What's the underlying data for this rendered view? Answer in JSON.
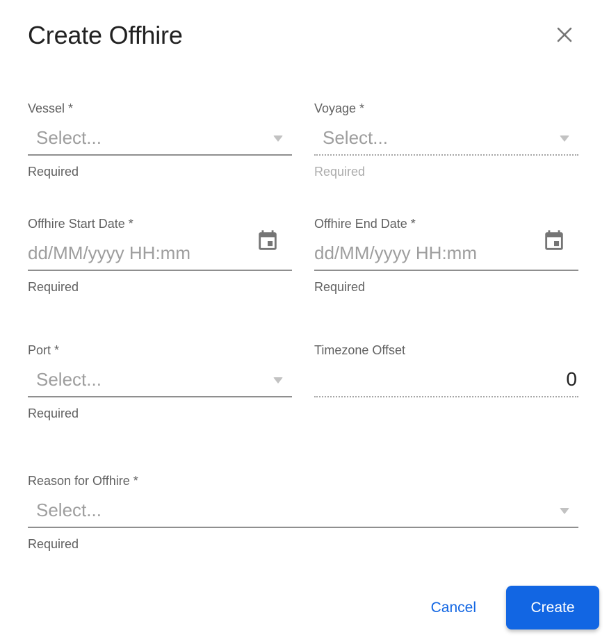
{
  "dialog": {
    "title": "Create Offhire"
  },
  "colors": {
    "accent_blue": "#1266E3",
    "title_text": "#212121",
    "label_text": "#616161",
    "placeholder_text": "#9E9E9E",
    "helper_text": "#616161",
    "helper_text_disabled": "#ABABAB",
    "underline_solid": "#8F8F8F",
    "underline_dotted": "#A6A6A6",
    "icon_gray": "#757575",
    "button_text_on_blue": "#FFFFFF"
  },
  "fields": {
    "vessel": {
      "label": "Vessel *",
      "placeholder": "Select...",
      "helper": "Required",
      "disabled": false
    },
    "voyage": {
      "label": "Voyage *",
      "placeholder": "Select...",
      "helper": "Required",
      "disabled": true
    },
    "offhire_start_date": {
      "label": "Offhire Start Date *",
      "placeholder": "dd/MM/yyyy HH:mm",
      "helper": "Required"
    },
    "offhire_end_date": {
      "label": "Offhire End Date *",
      "placeholder": "dd/MM/yyyy HH:mm",
      "helper": "Required"
    },
    "port": {
      "label": "Port *",
      "placeholder": "Select...",
      "helper": "Required",
      "disabled": false
    },
    "timezone_offset": {
      "label": "Timezone Offset",
      "value": "0",
      "disabled": true
    },
    "reason_for_offhire": {
      "label": "Reason for Offhire *",
      "placeholder": "Select...",
      "helper": "Required",
      "disabled": false
    }
  },
  "footer": {
    "cancel_label": "Cancel",
    "create_label": "Create"
  }
}
